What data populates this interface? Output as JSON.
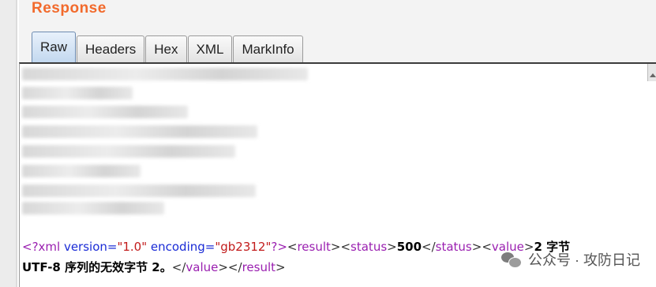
{
  "panel": {
    "title": "Response"
  },
  "tabs": [
    {
      "label": "Raw",
      "active": true
    },
    {
      "label": "Headers",
      "active": false
    },
    {
      "label": "Hex",
      "active": false
    },
    {
      "label": "XML",
      "active": false
    },
    {
      "label": "MarkInfo",
      "active": false
    }
  ],
  "body": {
    "line1": {
      "t1": "<?xml",
      "t2": " version=",
      "t3": "\"1.0\"",
      "t4": " encoding=",
      "t5": "\"gb2312\"",
      "t6": "?>",
      "t7": "<",
      "t8": "result",
      "t9": "><",
      "t10": "status",
      "t11": ">",
      "t12": "500",
      "t13": "</",
      "t14": "status",
      "t15": "><",
      "t16": "value",
      "t17": ">",
      "t18": "2 字节"
    },
    "line2": {
      "t1": "UTF-8 序列的无效字节 2。",
      "t2": "</",
      "t3": "value",
      "t4": "></",
      "t5": "result",
      "t6": ">"
    }
  },
  "watermark": {
    "text": "公众号 · 攻防日记",
    "icon": "wechat-icon"
  },
  "colors": {
    "title": "#f26a2c",
    "tag": "#9a1fb0",
    "attr": "#1a2bd6",
    "string": "#c21b1b"
  }
}
